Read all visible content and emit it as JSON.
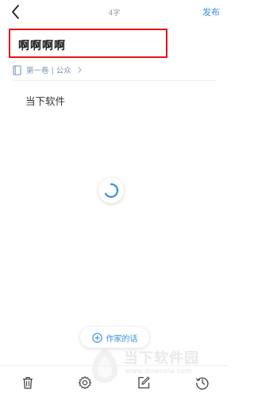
{
  "header": {
    "back_icon": "chevron-left-icon",
    "word_count": "4字",
    "publish_label": "发布"
  },
  "chapter": {
    "title": "啊啊啊啊",
    "volume": "第一卷 | 公众",
    "book_icon": "book-icon",
    "chevron_icon": "chevron-right-icon",
    "body": "当下软件"
  },
  "loading": {
    "icon": "loading-spinner-icon",
    "accent": "#3a8dde"
  },
  "author_note": {
    "label": "作家的话",
    "icon": "plus-circle-icon"
  },
  "watermark": {
    "title": "当下软件园",
    "url": "www.downxia.com"
  },
  "toolbar": {
    "items": [
      "trash-icon",
      "gear-icon",
      "edit-icon",
      "history-icon"
    ]
  },
  "colors": {
    "accent": "#3a8dde",
    "highlight_border": "#e5161c",
    "volume_text": "#7a95b3"
  }
}
